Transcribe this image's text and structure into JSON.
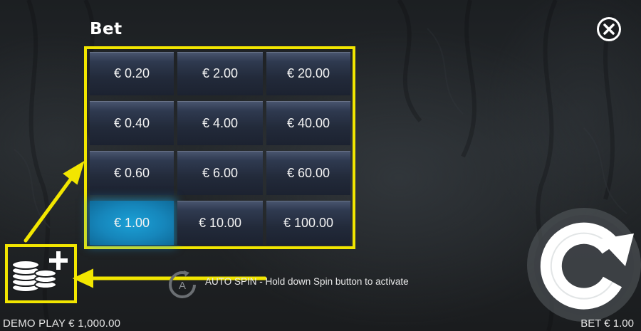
{
  "panel": {
    "title": "Bet",
    "bet_options": [
      {
        "label": "€ 0.20",
        "selected": false
      },
      {
        "label": "€ 2.00",
        "selected": false
      },
      {
        "label": "€ 20.00",
        "selected": false
      },
      {
        "label": "€ 0.40",
        "selected": false
      },
      {
        "label": "€ 4.00",
        "selected": false
      },
      {
        "label": "€ 40.00",
        "selected": false
      },
      {
        "label": "€ 0.60",
        "selected": false
      },
      {
        "label": "€ 6.00",
        "selected": false
      },
      {
        "label": "€ 60.00",
        "selected": false
      },
      {
        "label": "€ 1.00",
        "selected": true
      },
      {
        "label": "€ 10.00",
        "selected": false
      },
      {
        "label": "€ 100.00",
        "selected": false
      }
    ]
  },
  "autospin": {
    "icon_letter": "A",
    "text": "AUTO SPIN - Hold down Spin button to activate"
  },
  "footer": {
    "balance": "DEMO PLAY € 1,000.00",
    "bet": "BET € 1.00"
  },
  "colors": {
    "highlight": "#f2e600",
    "selected_bet": "#1aa0d6",
    "cell_bg": "#2f3a50"
  },
  "icons": {
    "close": "close-icon",
    "coins": "coins-plus-icon",
    "spin": "spin-arrow-icon",
    "autospin": "autospin-icon"
  }
}
